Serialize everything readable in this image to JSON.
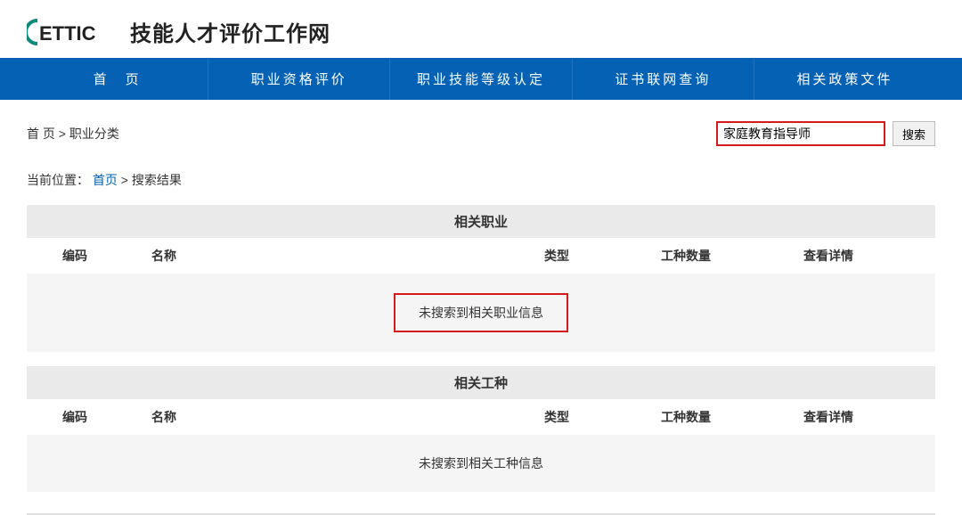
{
  "header": {
    "logo_text": "ETTIC",
    "site_title": "技能人才评价工作网"
  },
  "nav": {
    "items": [
      {
        "label": "首　页"
      },
      {
        "label": "职业资格评价"
      },
      {
        "label": "职业技能等级认定"
      },
      {
        "label": "证书联网查询"
      },
      {
        "label": "相关政策文件"
      }
    ]
  },
  "path_bar": {
    "text": "首 页 > 职业分类"
  },
  "search": {
    "value": "家庭教育指导师",
    "button": "搜索"
  },
  "breadcrumb": {
    "label": "当前位置：",
    "home": "首页",
    "sep": " > ",
    "current": "搜索结果"
  },
  "sections": {
    "occupation": {
      "title": "相关职业",
      "columns": {
        "code": "编码",
        "name": "名称",
        "type": "类型",
        "count": "工种数量",
        "detail": "查看详情"
      },
      "empty": "未搜索到相关职业信息"
    },
    "work_type": {
      "title": "相关工种",
      "columns": {
        "code": "编码",
        "name": "名称",
        "type": "类型",
        "count": "工种数量",
        "detail": "查看详情"
      },
      "empty": "未搜索到相关工种信息"
    }
  }
}
